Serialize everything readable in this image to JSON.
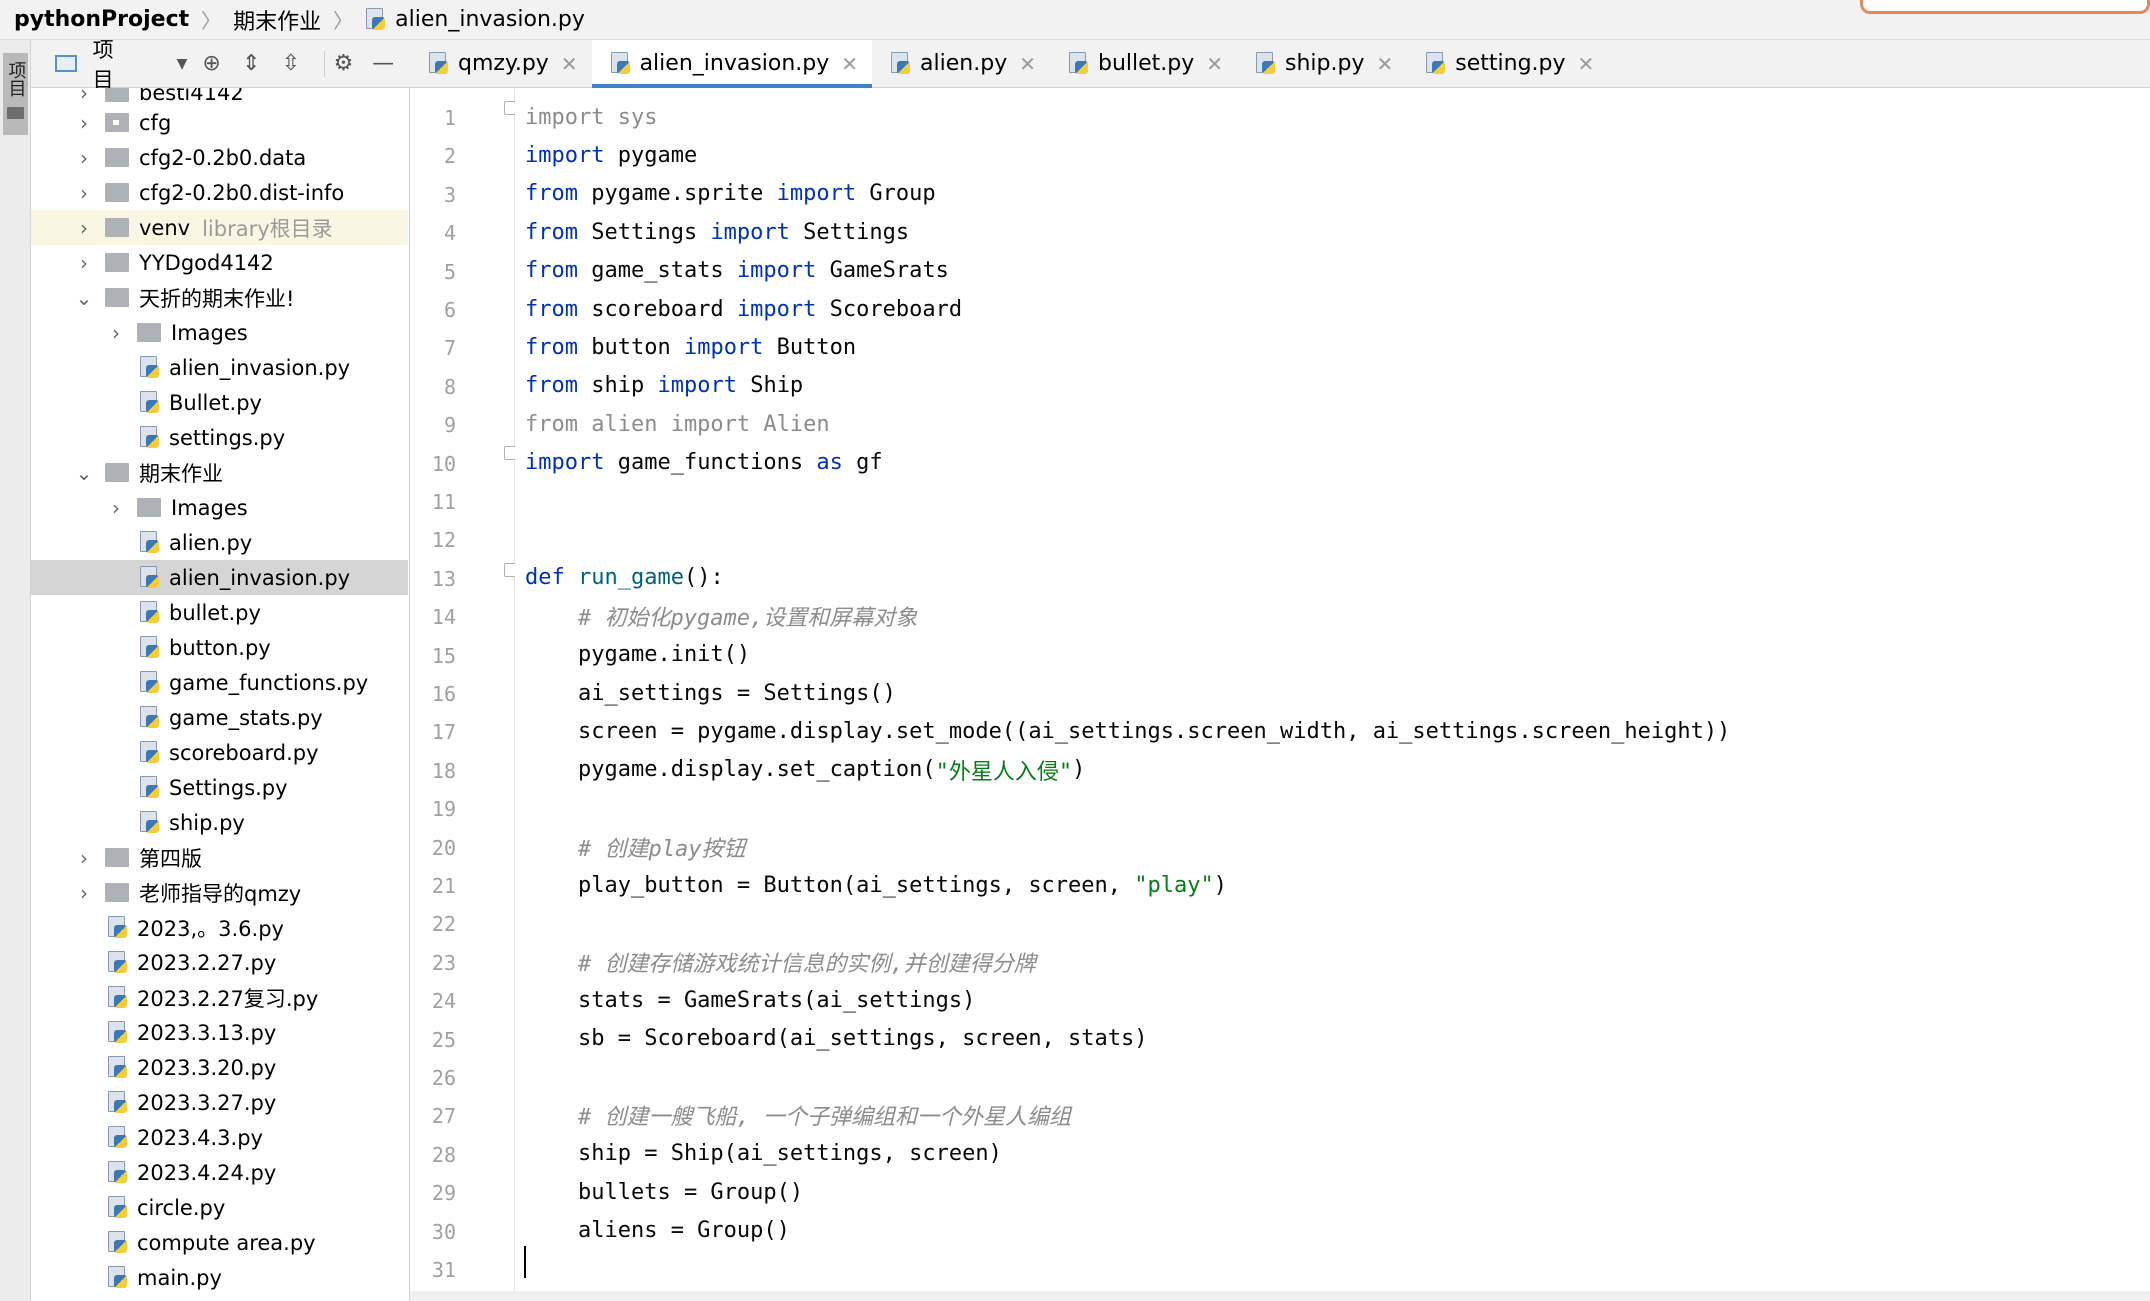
{
  "breadcrumb": {
    "project": "pythonProject",
    "folder": "期末作业",
    "file": "alien_invasion.py"
  },
  "toolwindow": {
    "label": "项目"
  },
  "project_panel": {
    "title": "项目"
  },
  "tabs": [
    {
      "label": "qmzy.py"
    },
    {
      "label": "alien_invasion.py"
    },
    {
      "label": "alien.py"
    },
    {
      "label": "bullet.py"
    },
    {
      "label": "ship.py"
    },
    {
      "label": "setting.py"
    }
  ],
  "tree": [
    {
      "name": "besti4142"
    },
    {
      "name": "cfg"
    },
    {
      "name": "cfg2-0.2b0.data"
    },
    {
      "name": "cfg2-0.2b0.dist-info"
    },
    {
      "name": "venv",
      "suffix": "library根目录"
    },
    {
      "name": "YYDgod4142"
    },
    {
      "name": "天折的期末作业!"
    },
    {
      "name": "Images"
    },
    {
      "name": "alien_invasion.py"
    },
    {
      "name": "Bullet.py"
    },
    {
      "name": "settings.py"
    },
    {
      "name": "期末作业"
    },
    {
      "name": "Images"
    },
    {
      "name": "alien.py"
    },
    {
      "name": "alien_invasion.py"
    },
    {
      "name": "bullet.py"
    },
    {
      "name": "button.py"
    },
    {
      "name": "game_functions.py"
    },
    {
      "name": "game_stats.py"
    },
    {
      "name": "scoreboard.py"
    },
    {
      "name": "Settings.py"
    },
    {
      "name": "ship.py"
    },
    {
      "name": "第四版"
    },
    {
      "name": "老师指导的qmzy"
    },
    {
      "name": "2023,。3.6.py"
    },
    {
      "name": "2023.2.27.py"
    },
    {
      "name": "2023.2.27复习.py"
    },
    {
      "name": "2023.3.13.py"
    },
    {
      "name": "2023.3.20.py"
    },
    {
      "name": "2023.3.27.py"
    },
    {
      "name": "2023.4.3.py"
    },
    {
      "name": "2023.4.24.py"
    },
    {
      "name": "circle.py"
    },
    {
      "name": "compute area.py"
    },
    {
      "name": "main.py"
    }
  ],
  "line_numbers": [
    "1",
    "2",
    "3",
    "4",
    "5",
    "6",
    "7",
    "8",
    "9",
    "10",
    "11",
    "12",
    "13",
    "14",
    "15",
    "16",
    "17",
    "18",
    "19",
    "20",
    "21",
    "22",
    "23",
    "24",
    "25",
    "26",
    "27",
    "28",
    "29",
    "30",
    "31"
  ],
  "code": [
    [
      {
        "t": "import sys",
        "c": "dim"
      }
    ],
    [
      {
        "t": "import",
        "c": "kw"
      },
      {
        "t": " pygame"
      }
    ],
    [
      {
        "t": "from",
        "c": "kw"
      },
      {
        "t": " pygame.sprite "
      },
      {
        "t": "import",
        "c": "kw"
      },
      {
        "t": " Group"
      }
    ],
    [
      {
        "t": "from",
        "c": "kw"
      },
      {
        "t": " Settings "
      },
      {
        "t": "import",
        "c": "kw"
      },
      {
        "t": " Settings"
      }
    ],
    [
      {
        "t": "from",
        "c": "kw"
      },
      {
        "t": " game_stats "
      },
      {
        "t": "import",
        "c": "kw"
      },
      {
        "t": " GameSrats"
      }
    ],
    [
      {
        "t": "from",
        "c": "kw"
      },
      {
        "t": " scoreboard "
      },
      {
        "t": "import",
        "c": "kw"
      },
      {
        "t": " Scoreboard"
      }
    ],
    [
      {
        "t": "from",
        "c": "kw"
      },
      {
        "t": " button "
      },
      {
        "t": "import",
        "c": "kw"
      },
      {
        "t": " Button"
      }
    ],
    [
      {
        "t": "from",
        "c": "kw"
      },
      {
        "t": " ship "
      },
      {
        "t": "import",
        "c": "kw"
      },
      {
        "t": " Ship"
      }
    ],
    [
      {
        "t": "from alien import Alien",
        "c": "dim"
      }
    ],
    [
      {
        "t": "import",
        "c": "kw"
      },
      {
        "t": " game_functions "
      },
      {
        "t": "as",
        "c": "kw"
      },
      {
        "t": " gf"
      }
    ],
    [],
    [],
    [
      {
        "t": "def",
        "c": "kw"
      },
      {
        "t": " "
      },
      {
        "t": "run_game",
        "c": "fn"
      },
      {
        "t": "():"
      }
    ],
    [
      {
        "t": "    "
      },
      {
        "t": "# 初始化pygame,设置和屏幕对象",
        "c": "cmt"
      }
    ],
    [
      {
        "t": "    pygame.init()"
      }
    ],
    [
      {
        "t": "    ai_settings = Settings()"
      }
    ],
    [
      {
        "t": "    screen = pygame.display.set_mode((ai_settings.screen_width, ai_settings.screen_height))"
      }
    ],
    [
      {
        "t": "    pygame.display.set_caption("
      },
      {
        "t": "\"外星人入侵\"",
        "c": "str"
      },
      {
        "t": ")"
      }
    ],
    [],
    [
      {
        "t": "    "
      },
      {
        "t": "# 创建play按钮",
        "c": "cmt"
      }
    ],
    [
      {
        "t": "    play_button = Button(ai_settings, screen, "
      },
      {
        "t": "\"play\"",
        "c": "str"
      },
      {
        "t": ")"
      }
    ],
    [],
    [
      {
        "t": "    "
      },
      {
        "t": "# 创建存储游戏统计信息的实例,并创建得分牌",
        "c": "cmt"
      }
    ],
    [
      {
        "t": "    stats = GameSrats(ai_settings)"
      }
    ],
    [
      {
        "t": "    sb = Scoreboard(ai_settings, screen, stats)"
      }
    ],
    [],
    [
      {
        "t": "    "
      },
      {
        "t": "# 创建一艘飞船, 一个子弹编组和一个外星人编组",
        "c": "cmt"
      }
    ],
    [
      {
        "t": "    ship = Ship(ai_settings, screen)"
      }
    ],
    [
      {
        "t": "    bullets = Group()"
      }
    ],
    [
      {
        "t": "    aliens = Group()"
      }
    ],
    []
  ]
}
